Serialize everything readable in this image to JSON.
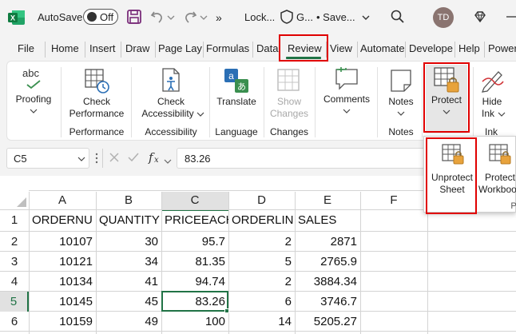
{
  "titlebar": {
    "app_icon": "excel-icon",
    "autosave_label": "AutoSave",
    "autosave_state": "Off",
    "more": "»",
    "lock_text": "Lock...",
    "sensitivity_text": "G...",
    "saved_text": "• Save...",
    "avatar_initials": "TD"
  },
  "menu_tabs": [
    "File",
    "Home",
    "Insert",
    "Draw",
    "Page Lay",
    "Formulas",
    "Data",
    "Review",
    "View",
    "Automate",
    "Develope",
    "Help",
    "Power"
  ],
  "ribbon": {
    "proofing": {
      "label": "Proofing",
      "icon_text": "abc"
    },
    "check_performance": {
      "line1": "Check",
      "line2": "Performance"
    },
    "group_performance": "Performance",
    "check_accessibility": {
      "line1": "Check",
      "line2": "Accessibility"
    },
    "group_accessibility": "Accessibility",
    "translate": {
      "label": "Translate"
    },
    "group_language": "Language",
    "show_changes": {
      "line1": "Show",
      "line2": "Changes"
    },
    "group_changes": "Changes",
    "comments": {
      "label": "Comments"
    },
    "notes": {
      "label": "Notes"
    },
    "group_notes": "Notes",
    "protect": {
      "label": "Protect"
    },
    "hide_ink": {
      "line1": "Hide",
      "line2": "Ink"
    },
    "group_ink": "Ink"
  },
  "protect_menu": {
    "unprotect_sheet": {
      "line1": "Unprotect",
      "line2": "Sheet"
    },
    "protect_workbook": {
      "line1": "Protect",
      "line2": "Workbook"
    },
    "group_partial": "P"
  },
  "formula_bar": {
    "name_box": "C5",
    "formula": "83.26"
  },
  "sheet": {
    "columns": [
      "A",
      "B",
      "C",
      "D",
      "E",
      "F"
    ],
    "row_numbers": [
      "1",
      "2",
      "3",
      "4",
      "5",
      "6"
    ],
    "rows": [
      [
        "ORDERNU",
        "QUANTITY",
        "PRICEEACH",
        "ORDERLIN",
        "SALES",
        ""
      ],
      [
        "10107",
        "30",
        "95.7",
        "2",
        "2871",
        ""
      ],
      [
        "10121",
        "34",
        "81.35",
        "5",
        "2765.9",
        ""
      ],
      [
        "10134",
        "41",
        "94.74",
        "2",
        "3884.34",
        ""
      ],
      [
        "10145",
        "45",
        "83.26",
        "6",
        "3746.7",
        ""
      ],
      [
        "10159",
        "49",
        "100",
        "14",
        "5205.27",
        ""
      ]
    ],
    "selected_cell": "C5"
  },
  "colors": {
    "accent": "#217346",
    "highlight": "#e00000"
  }
}
